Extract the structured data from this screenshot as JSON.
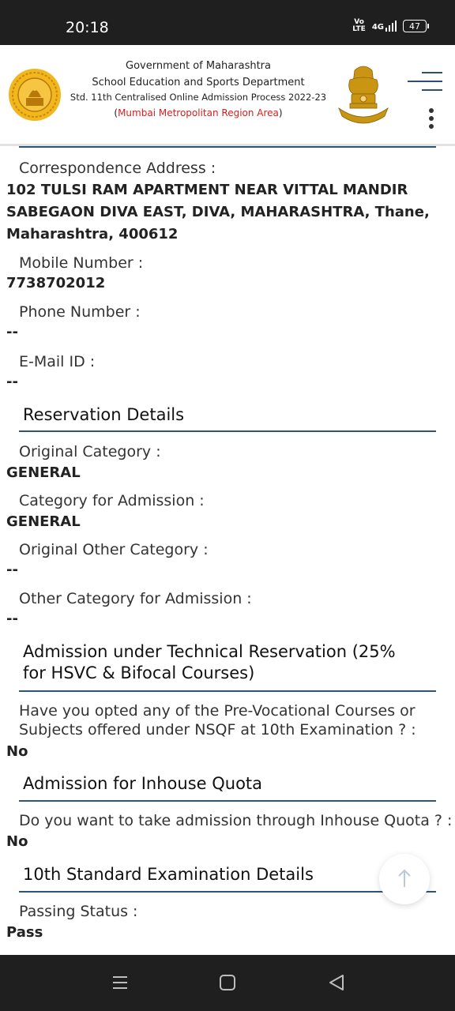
{
  "status_bar": {
    "time": "20:18",
    "volte": [
      "Vo",
      "LTE"
    ],
    "network": "4G",
    "battery": "47"
  },
  "header": {
    "line1": "Government of Maharashtra",
    "line2": "School Education and Sports Department",
    "line3": "Std. 11th Centralised Online Admission Process 2022-23",
    "region": "Mumbai Metropolitan Region Area",
    "paren_open": "(",
    "paren_close": ")"
  },
  "personal": {
    "correspondence_label": "Correspondence Address :",
    "correspondence_value": [
      "102 TULSI RAM APARTMENT NEAR VITTAL MANDIR",
      "SABEGAON DIVA EAST, DIVA, MAHARASHTRA, Thane,",
      "Maharashtra, 400612"
    ],
    "mobile_label": "Mobile Number :",
    "mobile_value": "7738702012",
    "phone_label": "Phone Number :",
    "phone_value": "--",
    "email_label": "E-Mail ID :",
    "email_value": "--"
  },
  "reservation": {
    "title": "Reservation Details",
    "original_category_label": "Original Category :",
    "original_category_value": "GENERAL",
    "admission_category_label": "Category for Admission :",
    "admission_category_value": "GENERAL",
    "original_other_label": "Original Other Category :",
    "original_other_value": "--",
    "other_admission_label": "Other Category for Admission :",
    "other_admission_value": "--"
  },
  "technical": {
    "title_lines": [
      "Admission under Technical Reservation (25%",
      "for HSVC & Bifocal Courses)"
    ],
    "question_lines": [
      "Have you opted any of the Pre-Vocational Courses or",
      "Subjects offered under NSQF at 10th Examination ? :"
    ],
    "answer": "No"
  },
  "inhouse": {
    "title": "Admission for Inhouse Quota",
    "question": "Do you want to take admission through Inhouse Quota ? :",
    "answer": "No"
  },
  "tenth": {
    "title": "10th Standard Examination Details",
    "passing_status_label": "Passing Status :",
    "passing_status_value": "Pass"
  },
  "colors": {
    "accent_line": "#2c5577",
    "region_red": "#d32121",
    "status_bar_bg": "#1f1f1f"
  },
  "icons": {
    "scroll_top": "arrow-up-icon",
    "menu": "hamburger-icon",
    "more": "kebab-icon",
    "nav_recent": "recent-apps-icon",
    "nav_home": "home-icon",
    "nav_back": "back-icon"
  }
}
